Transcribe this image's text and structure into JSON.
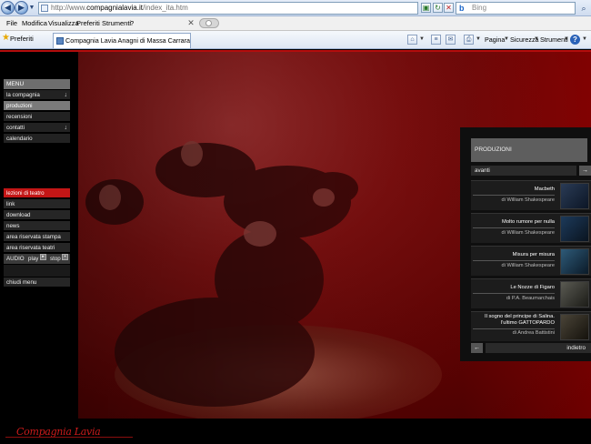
{
  "browser": {
    "url_prefix": "http://www.",
    "url_domain": "compagnialavia.it",
    "url_suffix": "/index_ita.htm",
    "search_placeholder": "Bing",
    "menu": [
      "File",
      "Modifica",
      "Visualizza",
      "Preferiti",
      "Strumenti",
      "?"
    ],
    "favorites_label": "Preferiti",
    "tab_title": "Compagnia Lavia Anagni di Massa Carrara - Teatro, C...",
    "commands": {
      "page": "Pagina",
      "security": "Sicurezza",
      "tools": "Strumenti"
    }
  },
  "site": {
    "logo_text": "Compagnia Lavia",
    "menu_title": "MENU",
    "menu_items": [
      "la compagnia",
      "produzioni",
      "recensioni",
      "contatti",
      "calendario"
    ],
    "secondary_items": [
      "lezioni di teatro",
      "link",
      "download",
      "news",
      "area riservata stampa",
      "area riservata teatri"
    ],
    "audio": {
      "label": "AUDIO",
      "play": "play",
      "stop": "stop"
    },
    "close_menu": "chiudi menu"
  },
  "productions": {
    "heading": "PRODUZIONI",
    "next_label": "avanti",
    "back_label": "indietro",
    "items": [
      {
        "title": "Macbeth",
        "author": "di William Shakespeare"
      },
      {
        "title": "Molto rumore per nulla",
        "author": "di William Shakespeare"
      },
      {
        "title": "Misura per misura",
        "author": "di William Shakespeare"
      },
      {
        "title": "Le Nozze di Figaro",
        "author": "di P.A. Beaumarchais"
      },
      {
        "title_line1": "Il sogno del principe di Salina.",
        "title_line2": "l'ultimo GATTOPARDO",
        "author": "di  Andrea Battistini"
      }
    ]
  },
  "colors": {
    "accent_red": "#c41616",
    "brand_red": "#cc1b1b"
  }
}
